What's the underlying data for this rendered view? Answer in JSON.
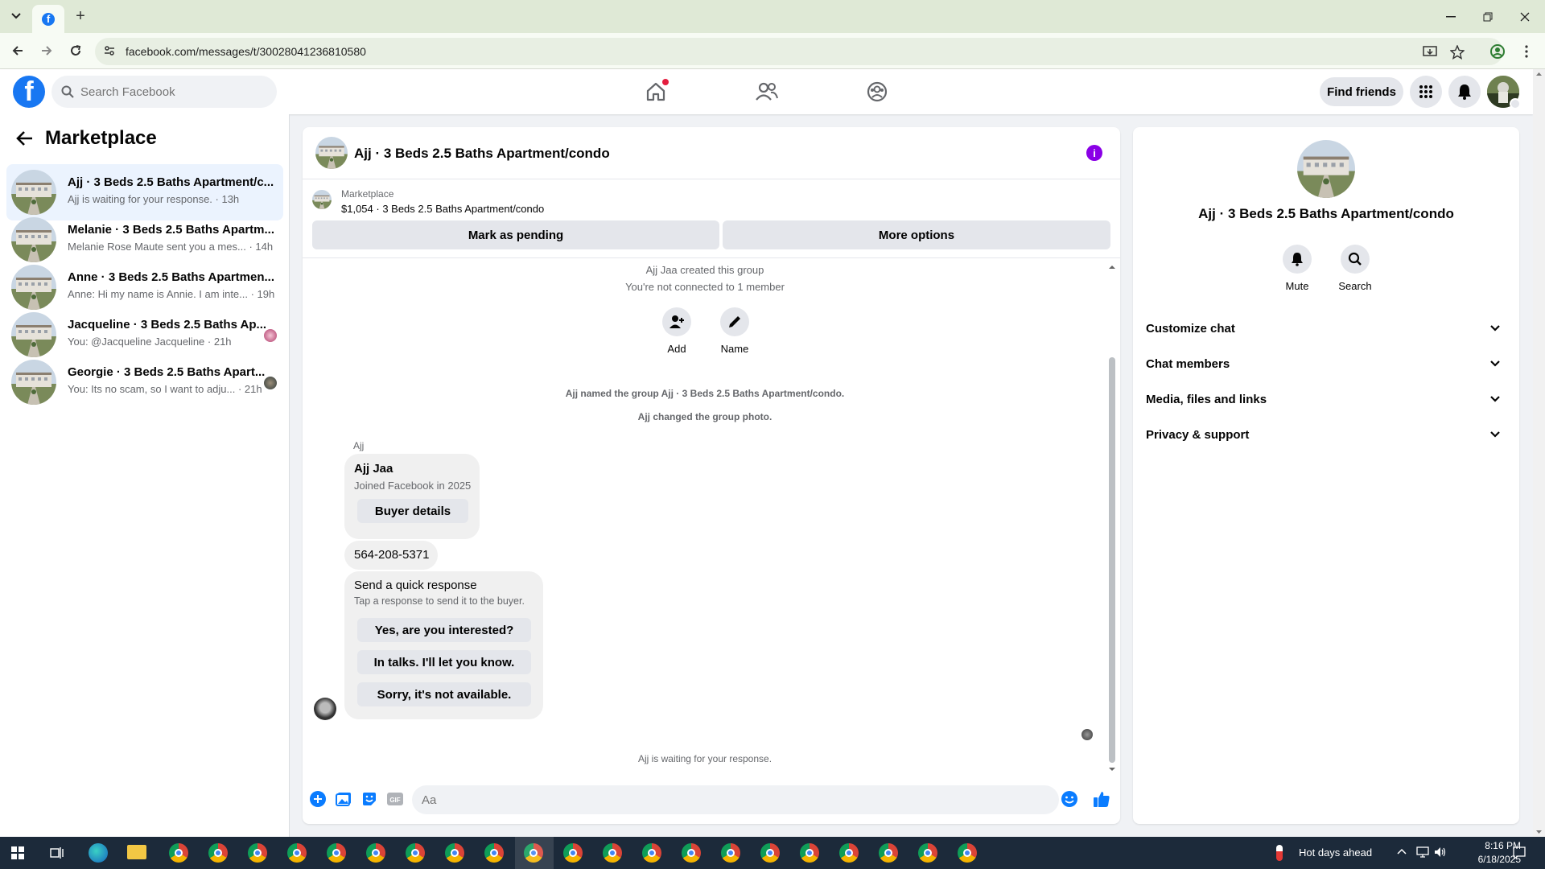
{
  "browser": {
    "url": "facebook.com/messages/t/30028041236810580"
  },
  "header": {
    "search_placeholder": "Search Facebook",
    "find_friends": "Find friends"
  },
  "sidebar": {
    "title": "Marketplace",
    "conversations": [
      {
        "name": "Ajj · 3 Beds 2.5 Baths Apartment/c...",
        "preview": "Ajj is waiting for your response. · 13h",
        "active": true
      },
      {
        "name": "Melanie · 3 Beds 2.5 Baths Apartm...",
        "preview": "Melanie Rose Maute sent you a mes... · 14h"
      },
      {
        "name": "Anne · 3 Beds 2.5 Baths Apartmen...",
        "preview": "Anne: Hi my name is Annie. I am inte... · 19h"
      },
      {
        "name": "Jacqueline · 3 Beds 2.5 Baths Ap...",
        "preview": "You: @Jacqueline Jacqueline · 21h"
      },
      {
        "name": "Georgie · 3 Beds 2.5 Baths Apart...",
        "preview": "You: Its no scam, so I want to adju... · 21h"
      }
    ]
  },
  "chat": {
    "title": "Ajj · 3 Beds 2.5 Baths Apartment/condo",
    "marketplace_label": "Marketplace",
    "listing": "$1,054 · 3 Beds 2.5 Baths Apartment/condo",
    "mark_pending": "Mark as pending",
    "more_options": "More options",
    "created": "Ajj Jaa created this group",
    "not_connected": "You're not connected to 1 member",
    "add_label": "Add",
    "name_label": "Name",
    "named_group": "Ajj named the group Ajj · 3 Beds 2.5 Baths Apartment/condo.",
    "changed_photo": "Ajj changed the group photo.",
    "sender": "Ajj",
    "profile_name": "Ajj Jaa",
    "profile_sub": "Joined Facebook in 2025",
    "buyer_details": "Buyer details",
    "phone": "564-208-5371",
    "quick_title": "Send a quick response",
    "quick_sub": "Tap a response to send it to the buyer.",
    "quick_1": "Yes, are you interested?",
    "quick_2": "In talks. I'll let you know.",
    "quick_3": "Sorry, it's not available.",
    "waiting": "Ajj is waiting for your response.",
    "composer_placeholder": "Aa"
  },
  "right_panel": {
    "title": "Ajj · 3 Beds 2.5 Baths Apartment/condo",
    "mute": "Mute",
    "search": "Search",
    "items": [
      "Customize chat",
      "Chat members",
      "Media, files and links",
      "Privacy & support"
    ]
  },
  "taskbar": {
    "weather": "Hot days ahead",
    "time": "8:16 PM",
    "date": "6/18/2025"
  },
  "colors": {
    "fb_blue": "#1877f2",
    "info_purple": "#8a00e6",
    "notification_red": "#e41e3f"
  }
}
